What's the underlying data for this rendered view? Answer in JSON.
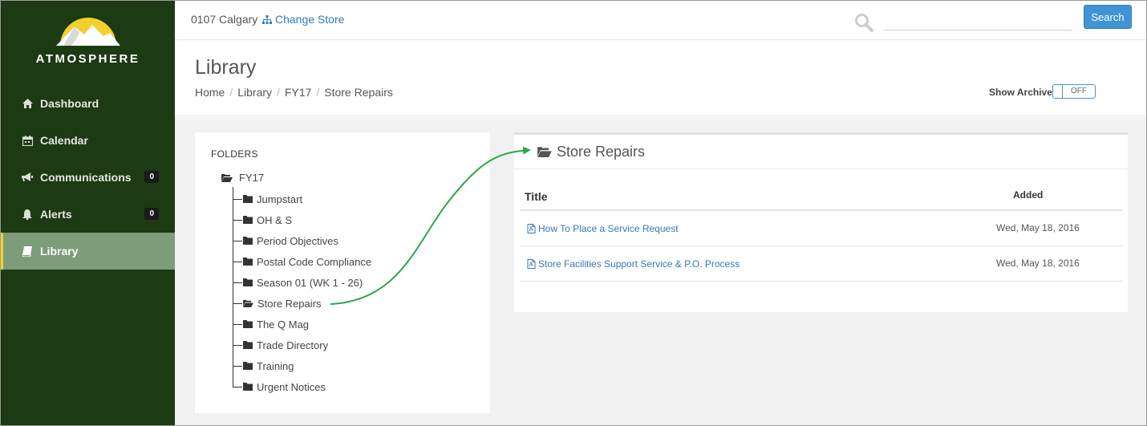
{
  "brand": {
    "name": "ATMOSPHERE",
    "logo_colors": {
      "sun": "#f5cf2b",
      "mountain": "#ffffff"
    }
  },
  "colors": {
    "sidebar": "#1c3a13",
    "active_item": "#7c9c7a",
    "active_accent": "#f5cf2b",
    "link": "#337ab7",
    "button": "#3f95d4",
    "arrow": "#2aa84a"
  },
  "sidebar": {
    "items": [
      {
        "label": "Dashboard",
        "icon": "home-icon",
        "active": false
      },
      {
        "label": "Calendar",
        "icon": "calendar-icon",
        "active": false
      },
      {
        "label": "Communications",
        "icon": "bullhorn-icon",
        "badge": "0",
        "active": false
      },
      {
        "label": "Alerts",
        "icon": "bell-icon",
        "badge": "0",
        "active": false
      },
      {
        "label": "Library",
        "icon": "book-icon",
        "active": true
      }
    ]
  },
  "topbar": {
    "store": "0107 Calgary",
    "change_store": "Change Store",
    "search_placeholder": "",
    "search_button": "Search"
  },
  "page": {
    "title": "Library",
    "breadcrumb": [
      "Home",
      "Library",
      "FY17",
      "Store Repairs"
    ],
    "archive_label": "Show Archive",
    "archive_toggle": "OFF"
  },
  "folders": {
    "title": "FOLDERS",
    "root": "FY17",
    "items": [
      {
        "label": "Jumpstart",
        "open": false
      },
      {
        "label": "OH & S",
        "open": false
      },
      {
        "label": "Period Objectives",
        "open": false
      },
      {
        "label": "Postal Code Compliance",
        "open": false
      },
      {
        "label": "Season 01 (WK 1 - 26)",
        "open": false
      },
      {
        "label": "Store Repairs",
        "open": true
      },
      {
        "label": "The Q Mag",
        "open": false
      },
      {
        "label": "Trade Directory",
        "open": false
      },
      {
        "label": "Training",
        "open": false
      },
      {
        "label": "Urgent Notices",
        "open": false
      }
    ]
  },
  "documents": {
    "folder_title": "Store Repairs",
    "columns": {
      "title": "Title",
      "added": "Added"
    },
    "rows": [
      {
        "title": "How To Place a Service Request",
        "added": "Wed, May 18, 2016"
      },
      {
        "title": "Store Facilities Support Service & P.O. Process",
        "added": "Wed, May 18, 2016"
      }
    ]
  }
}
